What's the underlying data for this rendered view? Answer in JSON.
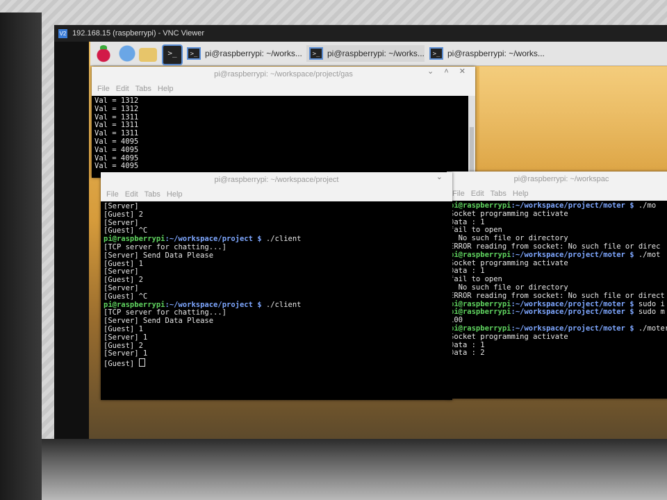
{
  "vnc_window": {
    "title": "192.168.15 (raspberrypi) - VNC Viewer",
    "logo": "V2"
  },
  "taskbar": {
    "tasks": [
      {
        "label": "pi@raspberrypi: ~/works..."
      },
      {
        "label": "pi@raspberrypi: ~/works..."
      },
      {
        "label": "pi@raspberrypi: ~/works..."
      }
    ],
    "term_glyph": ">_"
  },
  "windows": [
    {
      "title": "pi@raspberrypi: ~/workspace/project/gas",
      "menu": "File  Edit  Tabs  Help",
      "controls": "⌄ ˄ ✕",
      "lines": [
        "Val = 1312",
        "Val = 1312",
        "Val = 1311",
        "Val = 1311",
        "Val = 1311",
        "Val = 4095",
        "Val = 4095",
        "Val = 4095",
        "Val = 4095"
      ]
    },
    {
      "title": "pi@raspberrypi: ~/workspace/project",
      "menu": "File  Edit  Tabs  Help",
      "controls": "⌄",
      "lines": [
        "[Server]",
        "[Guest] 2",
        "[Server]",
        "[Guest] ^C",
        "PROMPT1",
        "[TCP server for chatting...]",
        "[Server] Send Data Please",
        "",
        "[Guest] 1",
        "[Server]",
        "[Guest] 2",
        "[Server]",
        "[Guest] ^C",
        "PROMPT2",
        "[TCP server for chatting...]",
        "[Server] Send Data Please",
        "",
        "[Guest] 1",
        "[Server] 1",
        "",
        "[Guest] 2",
        "[Server] 1",
        "",
        "[Guest] "
      ],
      "prompt_user": "pi@raspberrypi",
      "prompt_path": ":~/workspace/project $",
      "prompt_cmd": " ./client"
    },
    {
      "title": "pi@raspberrypi: ~/workspac",
      "menu": "File  Edit  Tabs  Help",
      "prompt_user": "pi@raspberrypi",
      "prompt_path": ":~/workspace/project/moter $",
      "lines": [
        {
          "p": true,
          "cmd": " ./mo"
        },
        {
          "t": "Socket programming activate"
        },
        {
          "t": "Data : 1"
        },
        {
          "t": ""
        },
        {
          "t": "fail to open"
        },
        {
          "t": ": No such file or directory"
        },
        {
          "t": "ERROR reading from socket: No such file or direc"
        },
        {
          "p": true,
          "cmd": " ./mot"
        },
        {
          "t": "Socket programming activate"
        },
        {
          "t": "Data : 1"
        },
        {
          "t": ""
        },
        {
          "t": "fail to open"
        },
        {
          "t": ": No such file or directory"
        },
        {
          "t": "ERROR reading from socket: No such file or direct"
        },
        {
          "p": true,
          "cmd": " sudo i"
        },
        {
          "p": true,
          "cmd": " sudo m"
        },
        {
          "t": "100"
        },
        {
          "p": true,
          "cmd": " ./moter"
        },
        {
          "t": "Socket programming activate"
        },
        {
          "t": "Data : 1"
        },
        {
          "t": ""
        },
        {
          "t": "Data : 2"
        }
      ]
    }
  ]
}
